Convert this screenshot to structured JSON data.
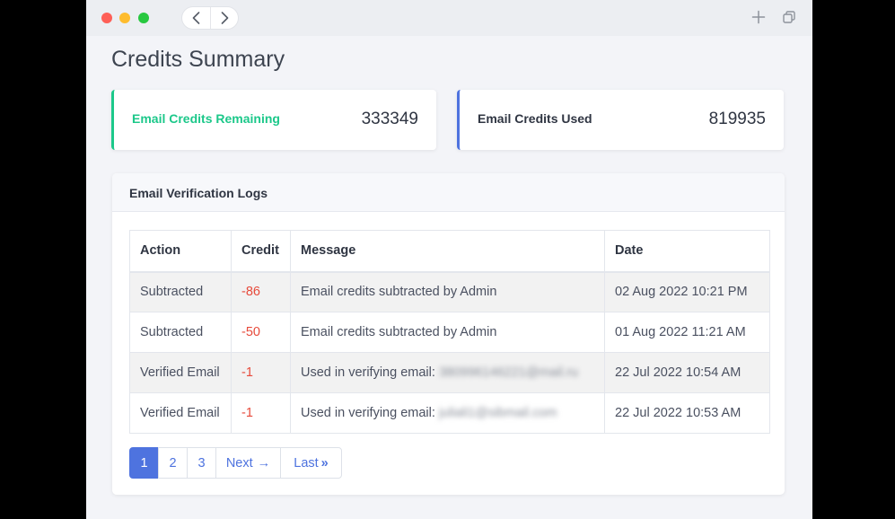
{
  "window": {
    "controls": [
      "close",
      "minimize",
      "maximize"
    ],
    "icons": {
      "back": "chevron-left-icon",
      "forward": "chevron-right-icon",
      "new_tab": "plus-icon",
      "tabs": "copy-icon"
    }
  },
  "page": {
    "title": "Credits Summary"
  },
  "cards": {
    "remaining": {
      "label": "Email Credits Remaining",
      "value": "333349",
      "accent": "#1cc88a"
    },
    "used": {
      "label": "Email Credits Used",
      "value": "819935",
      "accent": "#4e73df"
    }
  },
  "logs": {
    "title": "Email Verification Logs",
    "columns": [
      "Action",
      "Credit",
      "Message",
      "Date"
    ],
    "rows": [
      {
        "action": "Subtracted",
        "credit": "-86",
        "message": "Email credits subtracted by Admin",
        "email": "",
        "date": "02 Aug 2022 10:21 PM"
      },
      {
        "action": "Subtracted",
        "credit": "-50",
        "message": "Email credits subtracted by Admin",
        "email": "",
        "date": "01 Aug 2022 11:21 AM"
      },
      {
        "action": "Verified Email",
        "credit": "-1",
        "message": "Used in verifying email:",
        "email": "380996146221@mail.ru",
        "date": "22 Jul 2022 10:54 AM"
      },
      {
        "action": "Verified Email",
        "credit": "-1",
        "message": "Used in verifying email:",
        "email": "juliali1@sibmail.com",
        "date": "22 Jul 2022 10:53 AM"
      }
    ]
  },
  "pagination": {
    "pages": [
      "1",
      "2",
      "3"
    ],
    "active": "1",
    "next_label": "Next",
    "next_arrow": "→",
    "last_label": "Last",
    "last_arrow": "»"
  },
  "colors": {
    "negative": "#e74a3b",
    "primary": "#4e73df",
    "success": "#1cc88a"
  }
}
